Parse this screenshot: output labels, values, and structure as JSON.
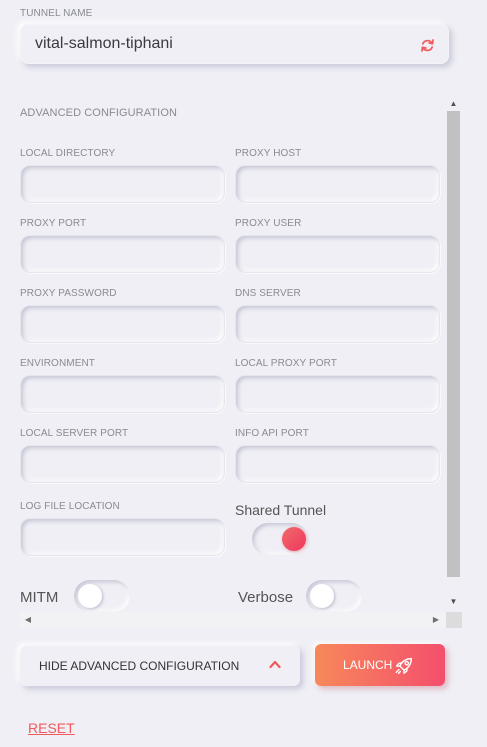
{
  "tunnel": {
    "label": "TUNNEL NAME",
    "value": "vital-salmon-tiphani",
    "refresh_icon": "refresh-icon"
  },
  "advanced": {
    "heading": "ADVANCED CONFIGURATION",
    "fields": {
      "local_directory": {
        "label": "LOCAL DIRECTORY",
        "value": ""
      },
      "proxy_host": {
        "label": "PROXY HOST",
        "value": ""
      },
      "proxy_port": {
        "label": "PROXY PORT",
        "value": ""
      },
      "proxy_user": {
        "label": "PROXY USER",
        "value": ""
      },
      "proxy_password": {
        "label": "PROXY PASSWORD",
        "value": ""
      },
      "dns_server": {
        "label": "DNS SERVER",
        "value": ""
      },
      "environment": {
        "label": "ENVIRONMENT",
        "value": ""
      },
      "local_proxy_port": {
        "label": "LOCAL PROXY PORT",
        "value": ""
      },
      "local_server_port": {
        "label": "LOCAL SERVER PORT",
        "value": ""
      },
      "info_api_port": {
        "label": "INFO API PORT",
        "value": ""
      },
      "log_file_location": {
        "label": "LOG FILE LOCATION",
        "value": ""
      }
    },
    "toggles": {
      "shared_tunnel": {
        "label": "Shared Tunnel",
        "on": true
      },
      "mitm": {
        "label": "MITM",
        "on": false
      },
      "verbose": {
        "label": "Verbose",
        "on": false
      }
    }
  },
  "actions": {
    "hide_advanced_label": "HIDE ADVANCED CONFIGURATION",
    "launch_label": "LAUNCH",
    "reset_label": "RESET"
  },
  "colors": {
    "background": "#efeff5",
    "accent": "#f05a5a",
    "launch_gradient_start": "#f7885a",
    "launch_gradient_end": "#f44f6d"
  }
}
